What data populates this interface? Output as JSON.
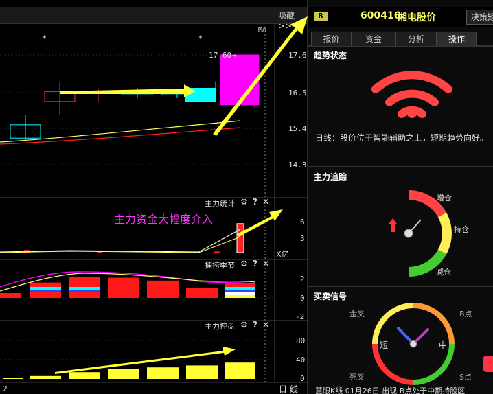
{
  "toolbar": {
    "hide_label": "隐藏>>",
    "ma_label": "MA"
  },
  "stock": {
    "badge": "R",
    "code": "600416",
    "name": "湘电股价",
    "decision_btn": "决策矩"
  },
  "tabs": [
    {
      "label": "报价"
    },
    {
      "label": "资金"
    },
    {
      "label": "分析"
    },
    {
      "label": "操作"
    }
  ],
  "chart": {
    "price_ticks": [
      "17.6",
      "16.5",
      "15.4",
      "14.3"
    ],
    "high_label": "17.60→",
    "stars": [
      "*",
      "*"
    ],
    "panel1_title": "主力统计",
    "panel1_ticks": [
      "6",
      "3"
    ],
    "panel1_unit": "X亿",
    "panel2_title": "捕捞季节",
    "panel2_ticks": [
      "2",
      "0",
      "-2"
    ],
    "panel3_title": "主力控盘",
    "panel3_ticks": [
      "80",
      "40",
      "0"
    ],
    "annotation": "主力资金大幅度介入",
    "bottom_left": "2",
    "period": "日  线",
    "icons": {
      "gear": "⚙",
      "help": "?",
      "close": "✕"
    }
  },
  "chart_data": {
    "type": "candlestick",
    "price_axis": [
      14.3,
      17.6
    ],
    "candles": [
      {
        "open": 15.5,
        "close": 15.1,
        "high": 15.8,
        "low": 15.0
      },
      {
        "open": 16.2,
        "close": 16.5,
        "high": 16.8,
        "low": 15.8
      },
      {
        "open": 16.5,
        "close": 16.5,
        "high": 16.6,
        "low": 16.2
      },
      {
        "open": 16.5,
        "close": 16.4,
        "high": 16.6,
        "low": 16.3
      },
      {
        "open": 16.5,
        "close": 16.4,
        "high": 16.5,
        "low": 16.3
      },
      {
        "open": 16.2,
        "close": 16.6,
        "high": 16.8,
        "low": 16.2
      },
      {
        "open": 16.1,
        "close": 17.6,
        "high": 17.6,
        "low": 16.0
      }
    ],
    "panel1_bars": [
      0.5,
      0.0,
      0.2,
      0.0,
      0.1,
      0.2,
      5.5
    ],
    "panel2_bars": [
      0.5,
      1.6,
      2.2,
      2.1,
      1.8,
      1.0,
      1.5
    ],
    "panel3_bars": [
      2,
      6,
      14,
      20,
      24,
      28,
      34
    ]
  },
  "trend": {
    "title": "趋势状态",
    "text": "日线：股价位于智能辅助之上，短期趋势向好。"
  },
  "tracking": {
    "title": "主力追踪",
    "add": "增仓",
    "hold": "持仓",
    "reduce": "减仓"
  },
  "signal": {
    "title": "买卖信号",
    "gold": "金叉",
    "b": "B点",
    "death": "死叉",
    "s": "S点",
    "short": "短",
    "mid": "中",
    "bottom_text": "慧眼K线  01月26日 出现 B点处于中期持股区"
  },
  "colors": {
    "accent": "#ffff66",
    "red": "#ff2020",
    "cyan": "#00ffff",
    "magenta": "#ff00ff"
  }
}
